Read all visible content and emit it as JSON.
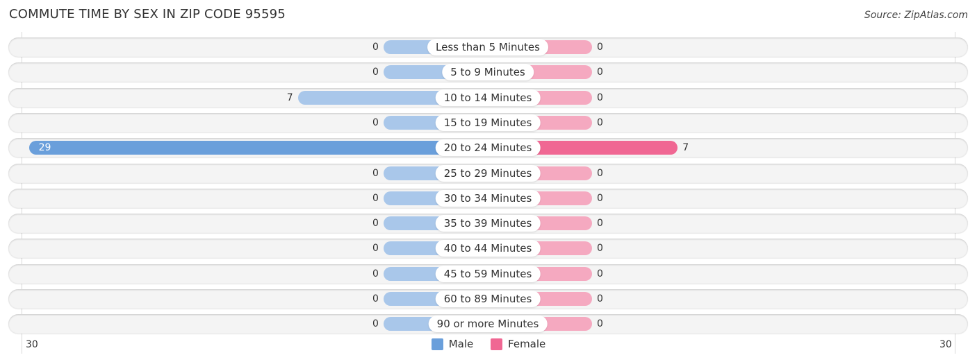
{
  "title": "COMMUTE TIME BY SEX IN ZIP CODE 95595",
  "source": "Source: ZipAtlas.com",
  "colors": {
    "male": "#6a9fdb",
    "male_light": "#a9c7ea",
    "female": "#f06793",
    "female_light": "#f5a9c0"
  },
  "chart_data": {
    "type": "bar",
    "orientation": "horizontal-diverging",
    "title": "COMMUTE TIME BY SEX IN ZIP CODE 95595",
    "categories": [
      "Less than 5 Minutes",
      "5 to 9 Minutes",
      "10 to 14 Minutes",
      "15 to 19 Minutes",
      "20 to 24 Minutes",
      "25 to 29 Minutes",
      "30 to 34 Minutes",
      "35 to 39 Minutes",
      "40 to 44 Minutes",
      "45 to 59 Minutes",
      "60 to 89 Minutes",
      "90 or more Minutes"
    ],
    "series": [
      {
        "name": "Male",
        "values": [
          0,
          0,
          7,
          0,
          29,
          0,
          0,
          0,
          0,
          0,
          0,
          0
        ]
      },
      {
        "name": "Female",
        "values": [
          0,
          0,
          0,
          0,
          7,
          0,
          0,
          0,
          0,
          0,
          0,
          0
        ]
      }
    ],
    "axis": {
      "left_tick": "30",
      "right_tick": "30",
      "range": [
        0,
        30
      ]
    },
    "legend": {
      "position": "bottom-center",
      "entries": [
        "Male",
        "Female"
      ]
    }
  }
}
